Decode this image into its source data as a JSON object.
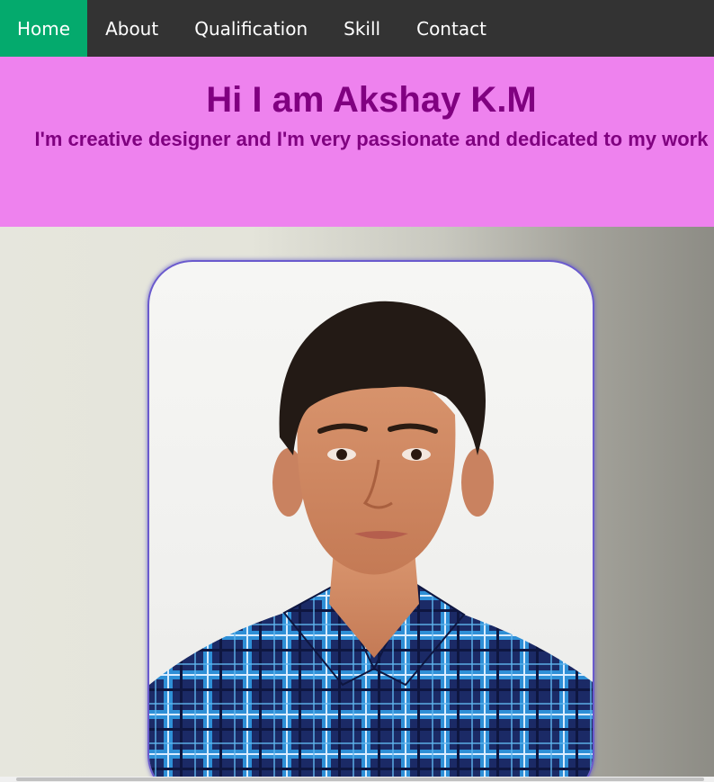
{
  "nav": {
    "items": [
      {
        "label": "Home",
        "active": true
      },
      {
        "label": "About",
        "active": false
      },
      {
        "label": "Qualification",
        "active": false
      },
      {
        "label": "Skill",
        "active": false
      },
      {
        "label": "Contact",
        "active": false
      }
    ],
    "active_color": "#04aa6d",
    "background": "#333333"
  },
  "hero": {
    "title": "Hi I am Akshay K.M",
    "subtitle": "I'm creative designer and I'm very passionate and dedicated to my work",
    "background": "#ee82ee",
    "text_color": "#800080"
  },
  "profile": {
    "image_subject": "portrait photo of a young man in a blue plaid shirt"
  }
}
